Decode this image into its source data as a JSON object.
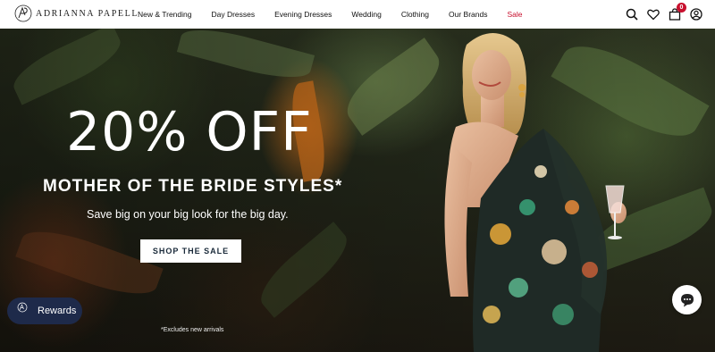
{
  "brand": {
    "name": "ADRIANNA PAPELL"
  },
  "nav": {
    "items": [
      {
        "label": "New & Trending"
      },
      {
        "label": "Day Dresses"
      },
      {
        "label": "Evening Dresses"
      },
      {
        "label": "Wedding"
      },
      {
        "label": "Clothing"
      },
      {
        "label": "Our Brands"
      },
      {
        "label": "Sale"
      }
    ]
  },
  "header_icons": {
    "search": "search-icon",
    "wishlist": "heart-icon",
    "cart": "bag-icon",
    "cart_count": "0",
    "account": "user-icon"
  },
  "hero": {
    "headline": "20% OFF",
    "subheadline": "MOTHER OF THE BRIDE STYLES*",
    "tagline": "Save big on your big look for the big day.",
    "cta_label": "SHOP THE SALE",
    "disclaimer": "*Excludes new arrivals"
  },
  "rewards": {
    "label": "Rewards",
    "logo_text": "ADRIANNA PAPELL"
  },
  "chat": {
    "icon": "chat-icon"
  },
  "colors": {
    "sale": "#c8102e",
    "rewards_bg": "#1e2a4a",
    "cta_text": "#1a2a3a"
  }
}
